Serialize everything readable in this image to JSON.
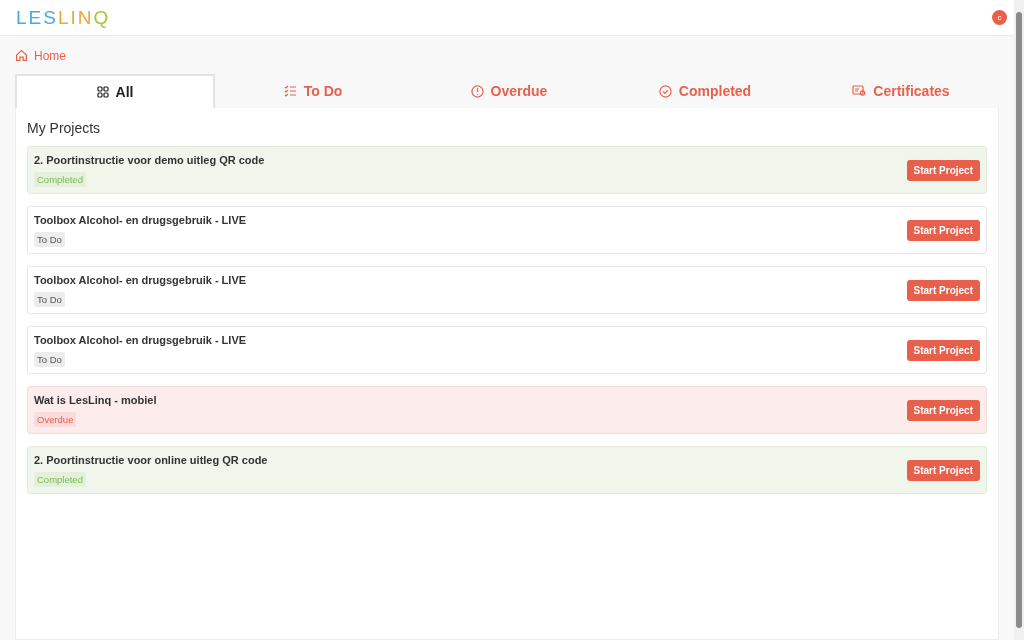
{
  "header": {
    "logo": "LESLINQ",
    "avatar": "c"
  },
  "breadcrumb": {
    "label": "Home"
  },
  "tabs": [
    {
      "label": "All",
      "kind": "all",
      "selected": true
    },
    {
      "label": "To Do",
      "kind": "todo",
      "selected": false
    },
    {
      "label": "Overdue",
      "kind": "overdue",
      "selected": false
    },
    {
      "label": "Completed",
      "kind": "completed",
      "selected": false
    },
    {
      "label": "Certificates",
      "kind": "certificates",
      "selected": false
    }
  ],
  "section_title": "My Projects",
  "projects": [
    {
      "title": "2. Poortinstructie voor demo uitleg QR code",
      "status": "Completed",
      "kind": "completed",
      "button": "Start Project"
    },
    {
      "title": "Toolbox Alcohol- en drugsgebruik - LIVE",
      "status": "To Do",
      "kind": "todo",
      "button": "Start Project"
    },
    {
      "title": "Toolbox Alcohol- en drugsgebruik - LIVE",
      "status": "To Do",
      "kind": "todo",
      "button": "Start Project"
    },
    {
      "title": "Toolbox Alcohol- en drugsgebruik - LIVE",
      "status": "To Do",
      "kind": "todo",
      "button": "Start Project"
    },
    {
      "title": "Wat is LesLinq - mobiel",
      "status": "Overdue",
      "kind": "overdue",
      "button": "Start Project"
    },
    {
      "title": "2. Poortinstructie voor online uitleg QR code",
      "status": "Completed",
      "kind": "completed",
      "button": "Start Project"
    }
  ]
}
